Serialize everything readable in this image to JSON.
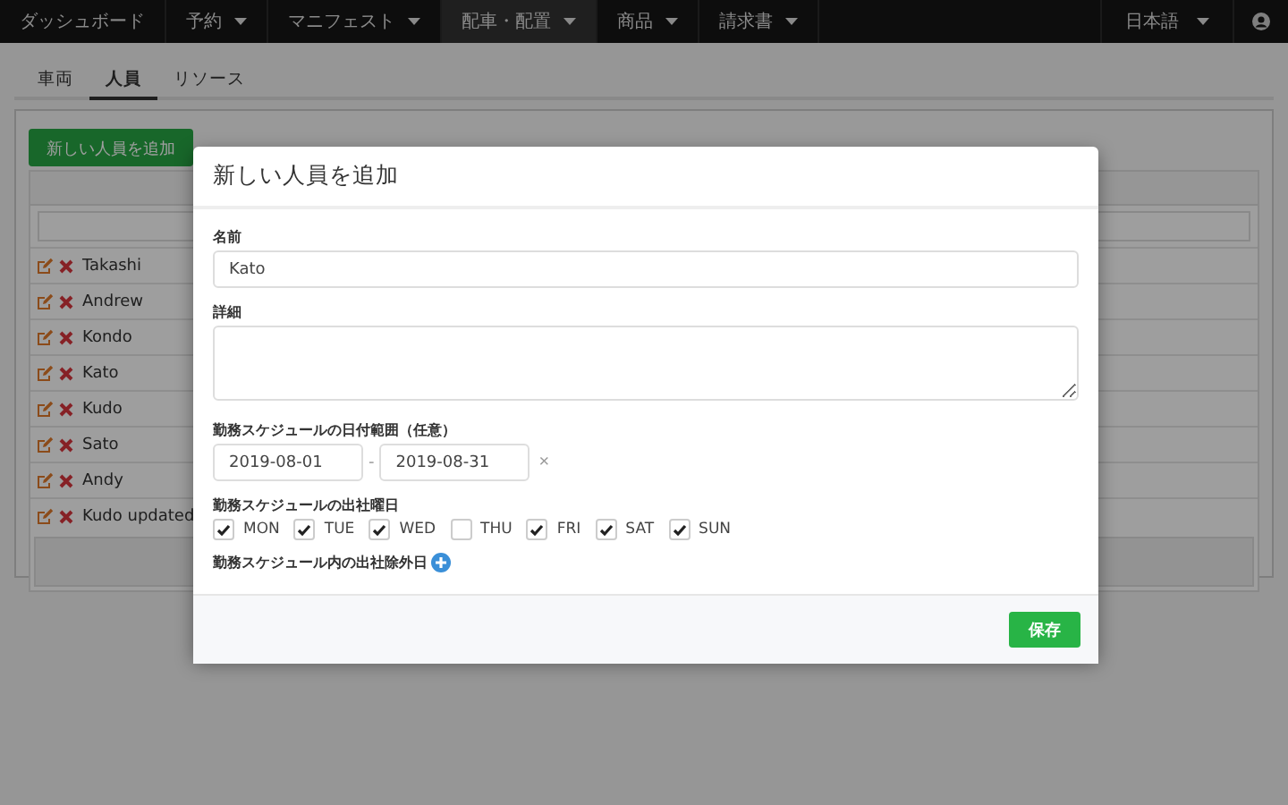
{
  "nav": {
    "items": [
      {
        "label": "ダッシュボード",
        "dropdown": false,
        "selected": false
      },
      {
        "label": "予約",
        "dropdown": true,
        "selected": false
      },
      {
        "label": "マニフェスト",
        "dropdown": true,
        "selected": false
      },
      {
        "label": "配車・配置",
        "dropdown": true,
        "selected": true
      },
      {
        "label": "商品",
        "dropdown": true,
        "selected": false
      },
      {
        "label": "請求書",
        "dropdown": true,
        "selected": false
      }
    ],
    "language": {
      "label": "日本語",
      "dropdown": true
    }
  },
  "tabs": [
    {
      "label": "車両",
      "selected": false
    },
    {
      "label": "人員",
      "selected": true
    },
    {
      "label": "リソース",
      "selected": false
    }
  ],
  "add_button": "新しい人員を追加",
  "people": [
    {
      "name": "Takashi"
    },
    {
      "name": "Andrew"
    },
    {
      "name": "Kondo"
    },
    {
      "name": "Kato"
    },
    {
      "name": "Kudo"
    },
    {
      "name": "Sato"
    },
    {
      "name": "Andy"
    },
    {
      "name": "Kudo updated"
    }
  ],
  "modal": {
    "title": "新しい人員を追加",
    "name": {
      "label": "名前",
      "value": "Kato"
    },
    "details": {
      "label": "詳細"
    },
    "date_range": {
      "label": "勤務スケジュールの日付範囲（任意）",
      "start": "2019-08-01",
      "separator": "-",
      "end": "2019-08-31",
      "clear": "×"
    },
    "workdays": {
      "label": "勤務スケジュールの出社曜日",
      "days": [
        {
          "label": "MON",
          "checked": true
        },
        {
          "label": "TUE",
          "checked": true
        },
        {
          "label": "WED",
          "checked": true
        },
        {
          "label": "THU",
          "checked": false
        },
        {
          "label": "FRI",
          "checked": true
        },
        {
          "label": "SAT",
          "checked": true
        },
        {
          "label": "SUN",
          "checked": true
        }
      ]
    },
    "exceptions": {
      "label": "勤務スケジュール内の出社除外日"
    },
    "save_button": "保存"
  }
}
